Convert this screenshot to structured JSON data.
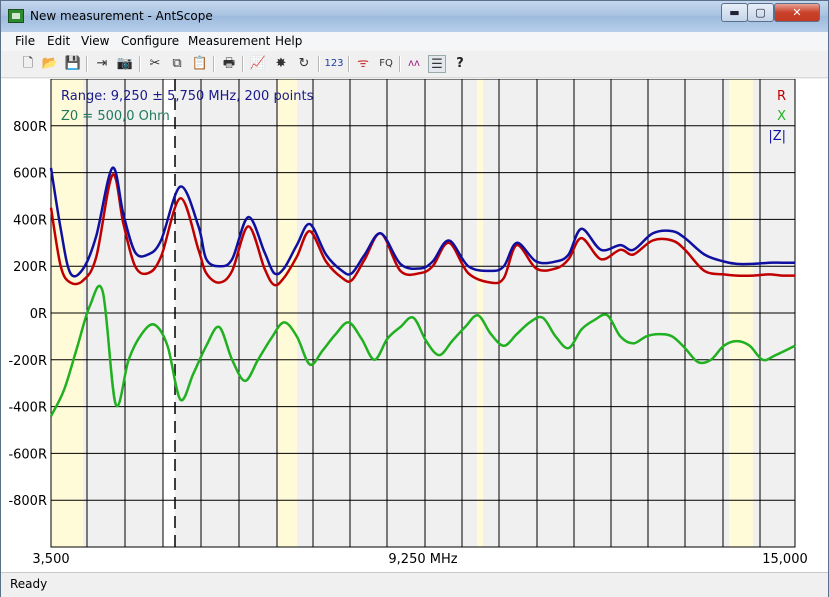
{
  "window": {
    "title": "New measurement - AntScope",
    "min_glyph": "▬",
    "max_glyph": "▢",
    "close_glyph": "✕"
  },
  "menu": [
    "File",
    "Edit",
    "View",
    "Configure",
    "Measurement",
    "Help"
  ],
  "toolbar_icons": [
    {
      "name": "new-file-icon",
      "glyph": "🗋"
    },
    {
      "name": "open-folder-icon",
      "glyph": "📂"
    },
    {
      "name": "save-icon",
      "glyph": "💾"
    },
    {
      "name": "export-icon",
      "glyph": "⇥"
    },
    {
      "name": "camera-icon",
      "glyph": "📷"
    },
    {
      "name": "cut-icon",
      "glyph": "✂"
    },
    {
      "name": "copy-icon",
      "glyph": "⧉"
    },
    {
      "name": "paste-icon",
      "glyph": "📋"
    },
    {
      "name": "print-icon",
      "glyph": "🖶"
    },
    {
      "name": "chart-icon",
      "glyph": "📈"
    },
    {
      "name": "burst-icon",
      "glyph": "✸"
    },
    {
      "name": "refresh-icon",
      "glyph": "↻"
    },
    {
      "name": "numbers-icon",
      "glyph": "123"
    },
    {
      "name": "antenna-icon",
      "glyph": "ᯤ"
    },
    {
      "name": "fq-icon",
      "glyph": "FQ"
    },
    {
      "name": "wave-icon",
      "glyph": "ʌʌ"
    },
    {
      "name": "list-icon",
      "glyph": "☰"
    },
    {
      "name": "help-icon",
      "glyph": "?"
    }
  ],
  "plot": {
    "info_range": "Range: 9,250 ± 5,750 MHz, 200 points",
    "info_z0": "Z0 = 500,0 Ohm",
    "legend": [
      {
        "label": "R",
        "color": "#c00000"
      },
      {
        "label": "X",
        "color": "#20b020"
      },
      {
        "label": "|Z|",
        "color": "#1010a0"
      }
    ],
    "y_ticks": [
      "800R",
      "600R",
      "400R",
      "200R",
      "0R",
      "-200R",
      "-400R",
      "-600R",
      "-800R"
    ],
    "x_label_left": "3,500",
    "x_label_center": "9,250 MHz",
    "x_label_right": "15,000"
  },
  "chart_data": {
    "type": "line",
    "x_unit": "MHz",
    "xlim": [
      3.5,
      15.0
    ],
    "ylim": [
      -1000,
      1000
    ],
    "grid": true,
    "series": [
      {
        "name": "R",
        "color": "#c00000",
        "x": [
          3.5,
          3.65,
          3.8,
          4.0,
          4.2,
          4.45,
          4.62,
          4.8,
          5.0,
          5.2,
          5.5,
          5.78,
          5.9,
          6.1,
          6.3,
          6.55,
          6.8,
          6.95,
          7.1,
          7.3,
          7.5,
          7.75,
          8.0,
          8.15,
          8.35,
          8.6,
          8.9,
          9.2,
          9.4,
          9.65,
          9.95,
          10.3,
          10.5,
          10.7,
          11.0,
          11.3,
          11.5,
          11.7,
          12.0,
          12.3,
          12.5,
          12.8,
          13.1,
          13.3,
          13.6,
          13.9,
          14.1,
          14.35,
          14.6,
          14.8,
          15.0
        ],
        "values": [
          450,
          200,
          130,
          140,
          240,
          590,
          380,
          200,
          170,
          240,
          490,
          270,
          170,
          130,
          180,
          370,
          190,
          120,
          150,
          240,
          350,
          220,
          150,
          140,
          230,
          340,
          180,
          170,
          200,
          300,
          170,
          130,
          150,
          290,
          190,
          190,
          230,
          320,
          230,
          270,
          250,
          310,
          310,
          270,
          180,
          165,
          160,
          160,
          165,
          160,
          160
        ]
      },
      {
        "name": "X",
        "color": "#20b020",
        "x": [
          3.5,
          3.7,
          3.9,
          4.1,
          4.3,
          4.5,
          4.7,
          4.9,
          5.1,
          5.3,
          5.5,
          5.7,
          5.9,
          6.1,
          6.3,
          6.5,
          6.7,
          6.9,
          7.1,
          7.3,
          7.5,
          7.7,
          7.9,
          8.1,
          8.3,
          8.5,
          8.7,
          8.9,
          9.1,
          9.3,
          9.5,
          9.7,
          9.9,
          10.1,
          10.3,
          10.5,
          10.7,
          10.9,
          11.1,
          11.3,
          11.5,
          11.7,
          11.9,
          12.1,
          12.3,
          12.5,
          12.7,
          12.9,
          13.1,
          13.3,
          13.5,
          13.7,
          13.9,
          14.1,
          14.3,
          14.5,
          14.7,
          15.0
        ],
        "values": [
          -440,
          -330,
          -150,
          30,
          90,
          -390,
          -200,
          -90,
          -50,
          -140,
          -370,
          -260,
          -140,
          -60,
          -200,
          -290,
          -200,
          -110,
          -40,
          -100,
          -220,
          -160,
          -90,
          -40,
          -110,
          -200,
          -110,
          -60,
          -20,
          -120,
          -180,
          -120,
          -60,
          -10,
          -90,
          -140,
          -90,
          -40,
          -20,
          -100,
          -150,
          -70,
          -30,
          -10,
          -100,
          -130,
          -100,
          -90,
          -100,
          -150,
          -210,
          -200,
          -140,
          -120,
          -140,
          -200,
          -180,
          -140
        ]
      },
      {
        "name": "|Z|",
        "color": "#1010a0",
        "x": [
          3.5,
          3.65,
          3.8,
          4.0,
          4.2,
          4.45,
          4.62,
          4.8,
          5.0,
          5.2,
          5.5,
          5.78,
          5.9,
          6.1,
          6.3,
          6.55,
          6.8,
          6.95,
          7.1,
          7.3,
          7.5,
          7.75,
          8.0,
          8.15,
          8.35,
          8.6,
          8.9,
          9.2,
          9.4,
          9.65,
          9.95,
          10.3,
          10.5,
          10.7,
          11.0,
          11.3,
          11.5,
          11.7,
          12.0,
          12.3,
          12.5,
          12.8,
          13.1,
          13.3,
          13.6,
          13.9,
          14.1,
          14.35,
          14.6,
          14.8,
          15.0
        ],
        "values": [
          620,
          360,
          170,
          190,
          330,
          620,
          420,
          260,
          250,
          310,
          540,
          370,
          230,
          200,
          230,
          410,
          260,
          170,
          190,
          290,
          380,
          250,
          180,
          170,
          250,
          340,
          210,
          190,
          220,
          310,
          200,
          180,
          200,
          300,
          220,
          220,
          250,
          360,
          270,
          290,
          270,
          340,
          350,
          320,
          250,
          220,
          210,
          210,
          215,
          215,
          215
        ]
      }
    ]
  },
  "status": "Ready"
}
